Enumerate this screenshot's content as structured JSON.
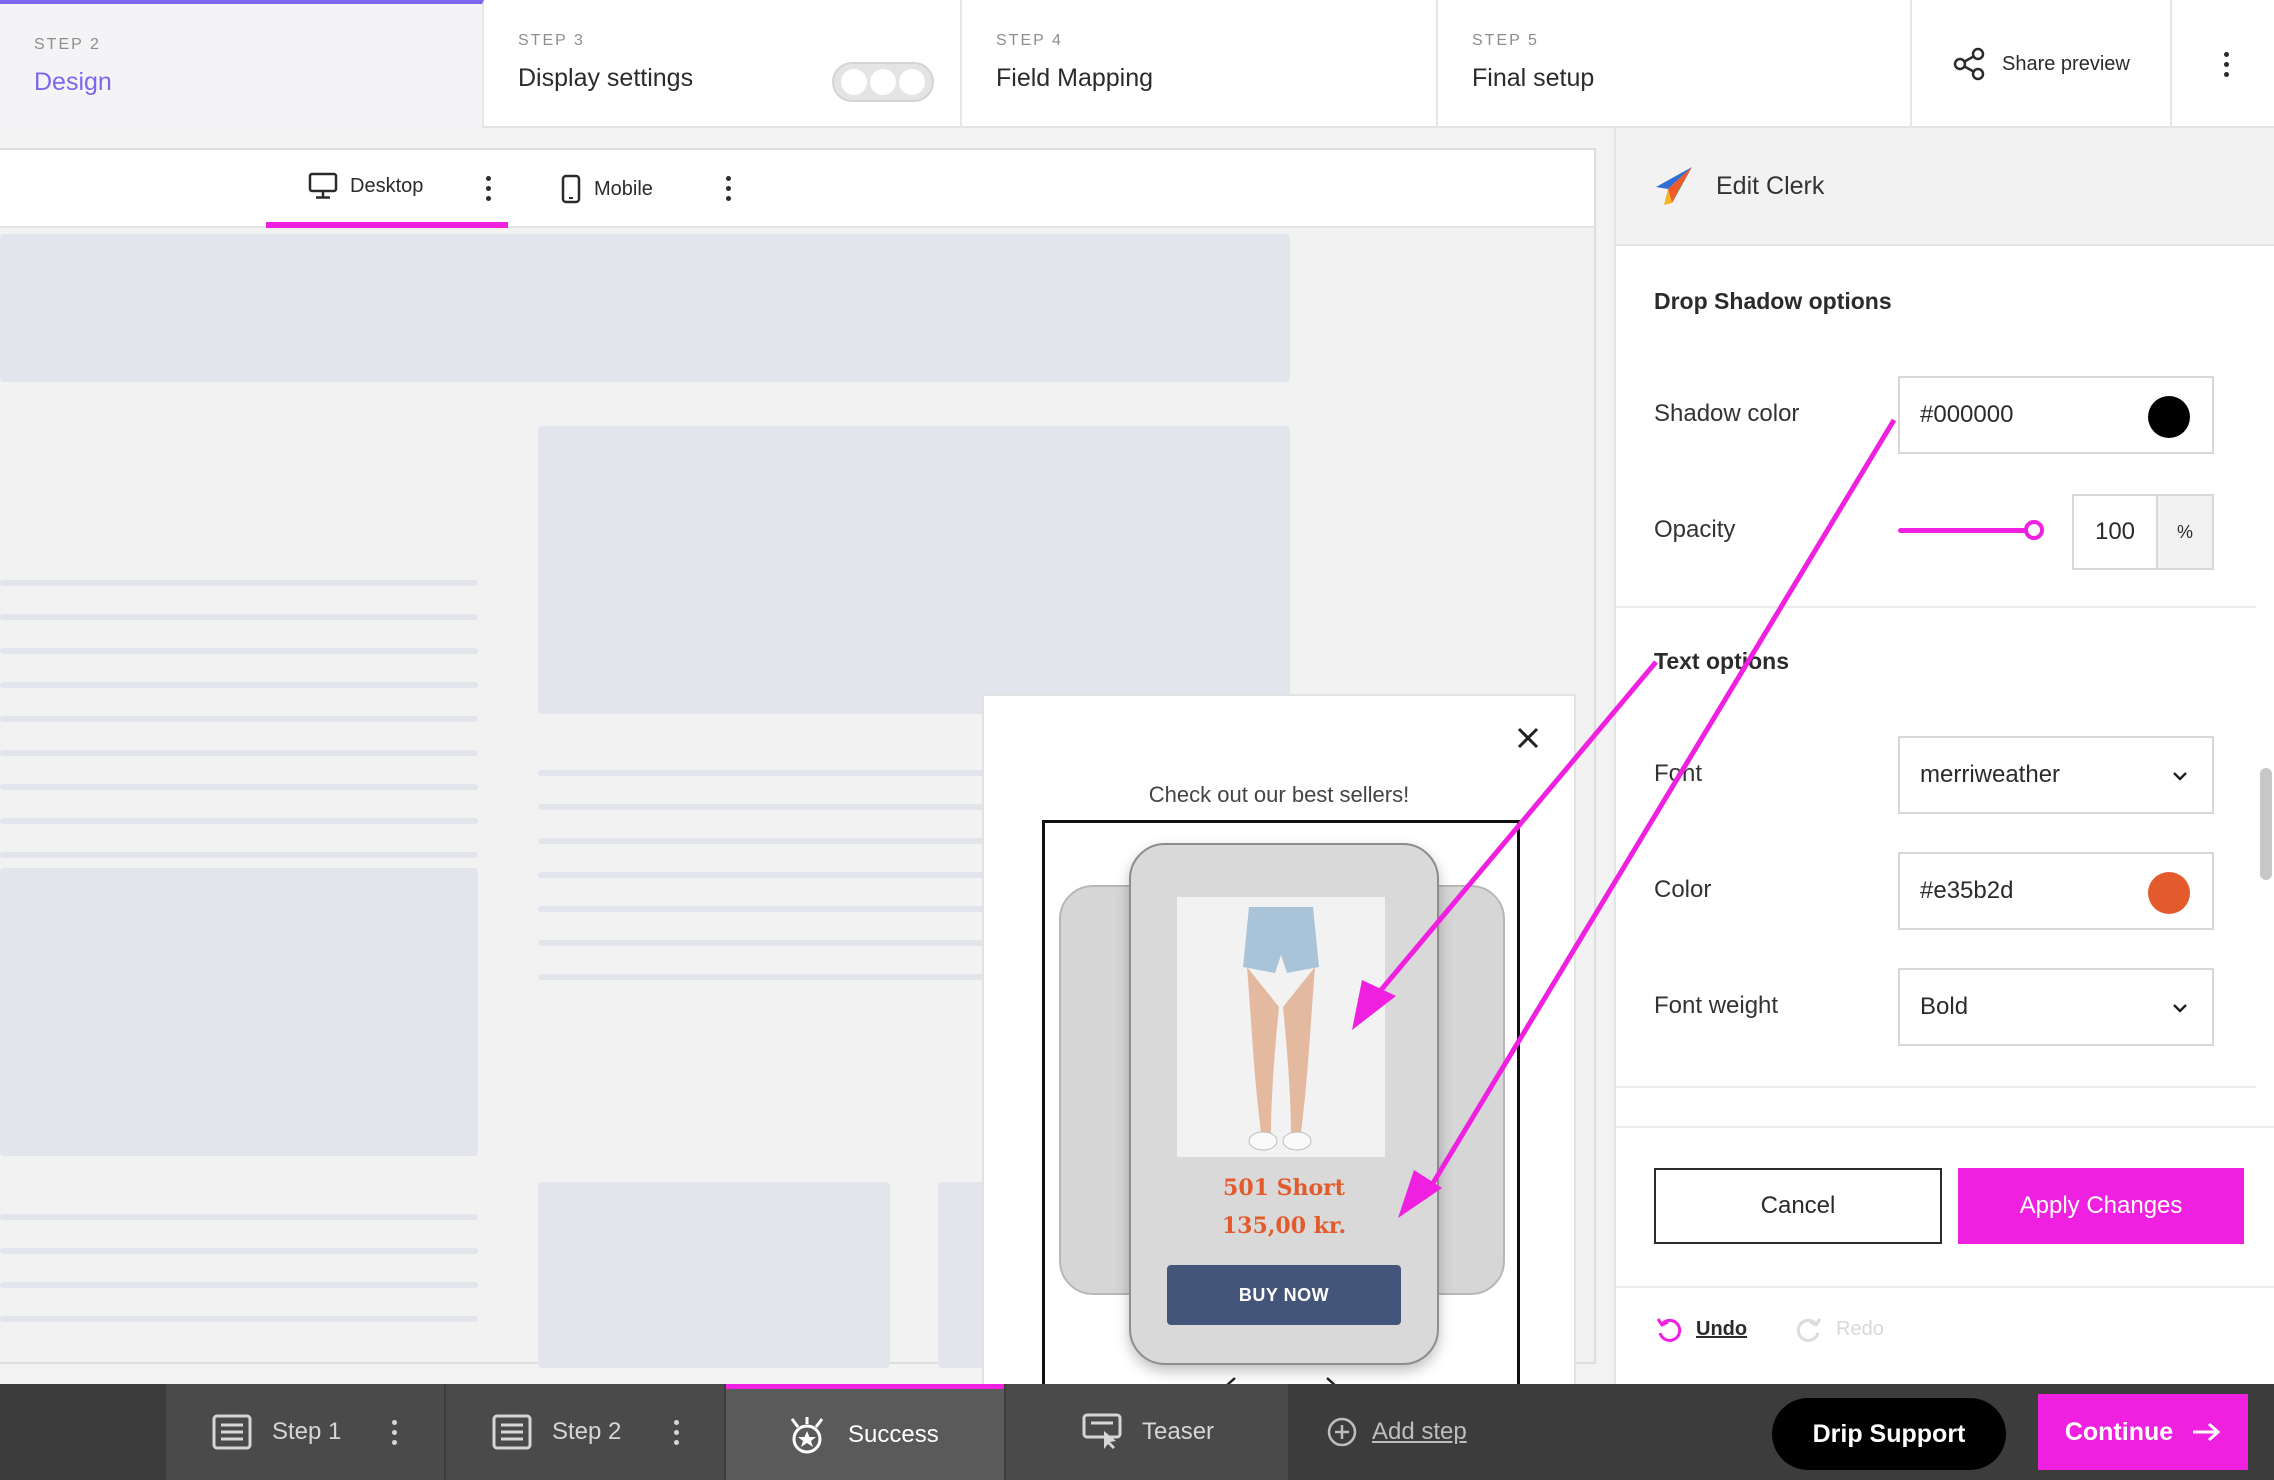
{
  "steps": [
    {
      "label": "STEP 2",
      "title": "Design"
    },
    {
      "label": "STEP 3",
      "title": "Display settings"
    },
    {
      "label": "STEP 4",
      "title": "Field Mapping"
    },
    {
      "label": "STEP 5",
      "title": "Final setup"
    }
  ],
  "share_label": "Share preview",
  "devices": {
    "desktop": "Desktop",
    "mobile": "Mobile"
  },
  "popup": {
    "headline": "Check out our best sellers!",
    "product_name": "501 Short",
    "product_price": "135,00 kr.",
    "buy_label": "BUY NOW"
  },
  "panel": {
    "title": "Edit Clerk",
    "shadow_section": "Drop Shadow options",
    "shadow_color_label": "Shadow color",
    "shadow_color_value": "#000000",
    "opacity_label": "Opacity",
    "opacity_value": "100",
    "opacity_unit": "%",
    "opacity_level": 1.0,
    "text_section": "Text options",
    "font_label": "Font",
    "font_value": "merriweather",
    "color_label": "Color",
    "color_value": "#e35b2d",
    "weight_label": "Font weight",
    "weight_value": "Bold",
    "cancel_label": "Cancel",
    "apply_label": "Apply Changes",
    "undo_label": "Undo",
    "redo_label": "Redo"
  },
  "bottom": {
    "tabs": [
      "Step 1",
      "Step 2",
      "Success",
      "Teaser"
    ],
    "add_step": "Add step",
    "support": "Drip Support",
    "continue": "Continue"
  },
  "colors": {
    "accent": "#f020e0",
    "purple": "#7b68ee",
    "text_color": "#e35b2d",
    "shadow_color": "#000000",
    "button": "#44557a"
  }
}
